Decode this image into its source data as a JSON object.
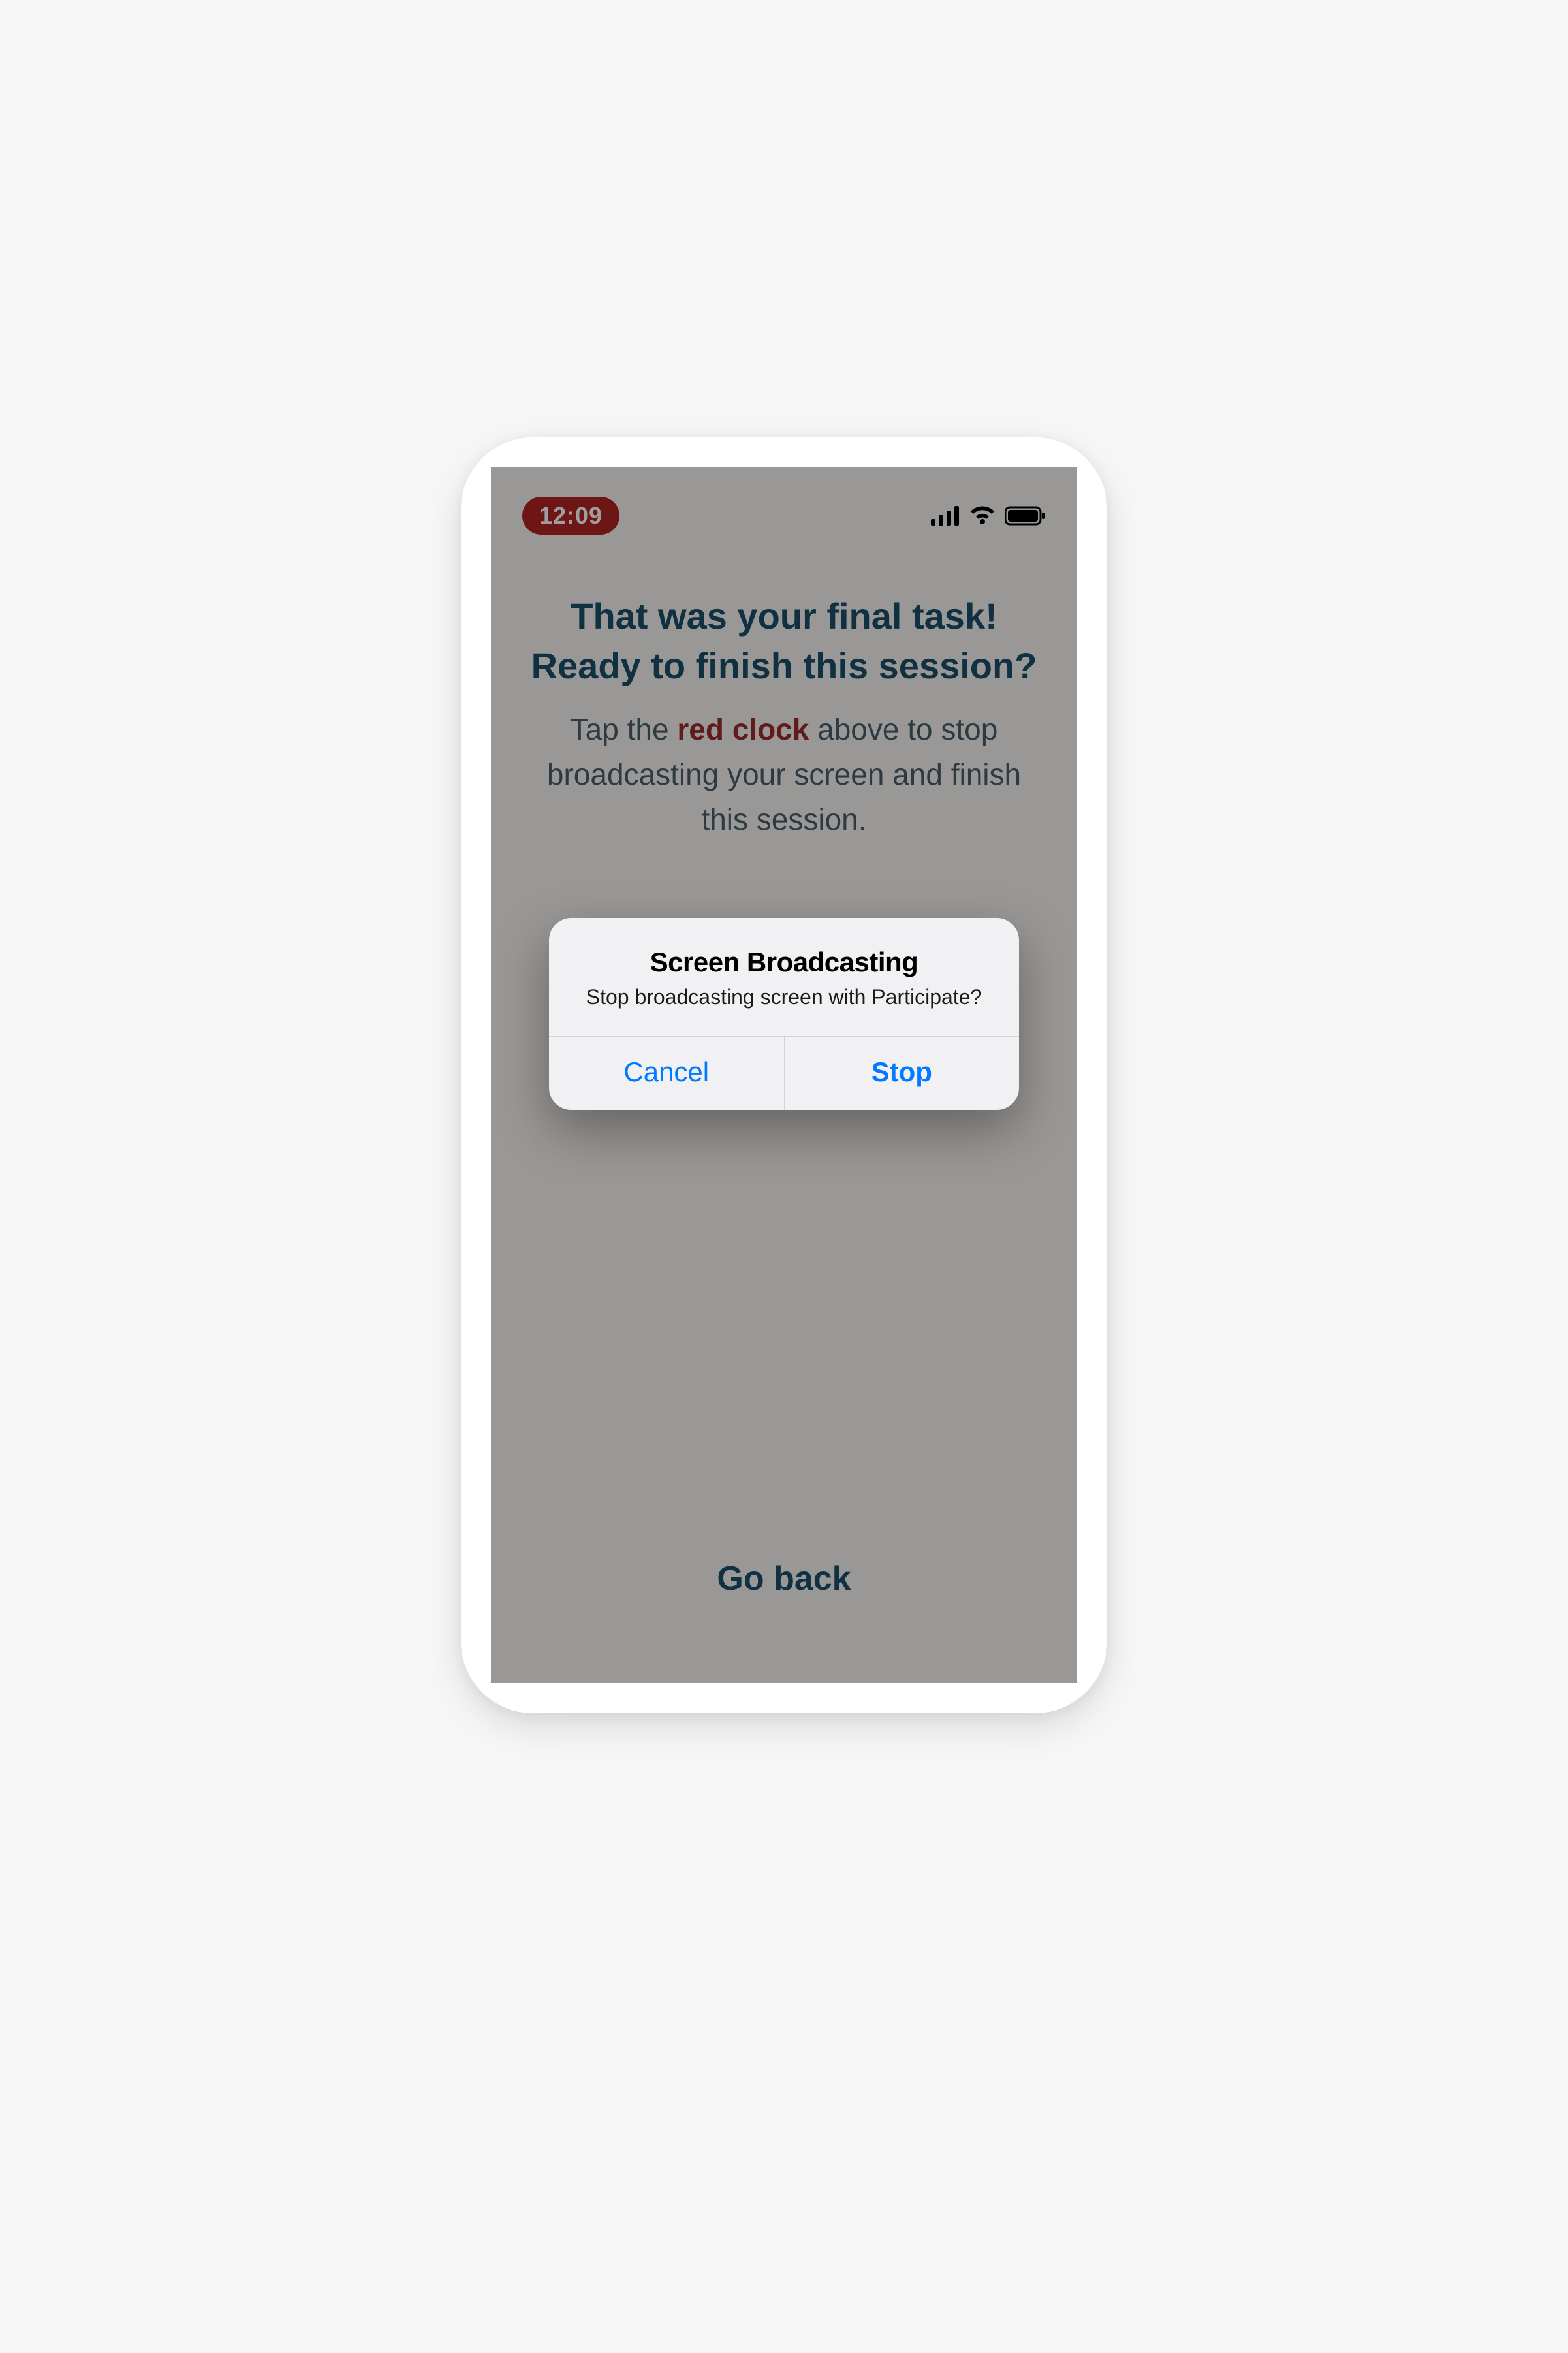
{
  "statusBar": {
    "time": "12:09"
  },
  "heading": {
    "line1": "That was your final task!",
    "line2": "Ready to finish this session?"
  },
  "instruction": {
    "prefix": "Tap the ",
    "emphasis": "red clock",
    "suffix": " above to stop broadcasting your screen and finish this session."
  },
  "goBack": "Go back",
  "alert": {
    "title": "Screen Broadcasting",
    "message": "Stop broadcasting screen with Participate?",
    "cancel": "Cancel",
    "confirm": "Stop"
  },
  "colors": {
    "recordingPill": "#b22222",
    "headingText": "#1a4f6a",
    "bodyText": "#4a5e6b",
    "emphasisText": "#9b2c2c",
    "alertAction": "#007aff"
  }
}
